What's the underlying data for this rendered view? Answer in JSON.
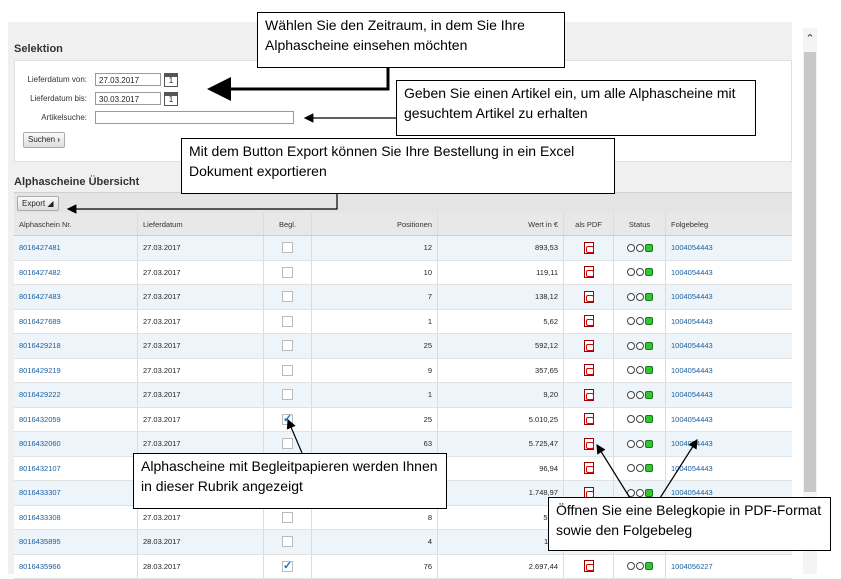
{
  "selektion": {
    "title": "Selektion",
    "lieferdatum_von_label": "Lieferdatum von:",
    "lieferdatum_von_value": "27.03.2017",
    "lieferdatum_bis_label": "Lieferdatum bis:",
    "lieferdatum_bis_value": "30.03.2017",
    "calendar_day": "1",
    "artikelsuche_label": "Artikelsuche:",
    "artikelsuche_value": "",
    "suchen_label": "Suchen",
    "suchen_chevron": "›"
  },
  "overview": {
    "title": "Alphascheine Übersicht",
    "export_label": "Export"
  },
  "table": {
    "headers": [
      "Alphaschein Nr.",
      "Lieferdatum",
      "Begl.",
      "Positionen",
      "Wert in €",
      "als PDF",
      "Status",
      "Folgebeleg"
    ],
    "rows": [
      {
        "nr": "8016427481",
        "datum": "27.03.2017",
        "begl": false,
        "pos": "12",
        "wert": "893,53",
        "folge": "1004054443"
      },
      {
        "nr": "8016427482",
        "datum": "27.03.2017",
        "begl": false,
        "pos": "10",
        "wert": "119,11",
        "folge": "1004054443"
      },
      {
        "nr": "8016427483",
        "datum": "27.03.2017",
        "begl": false,
        "pos": "7",
        "wert": "138,12",
        "folge": "1004054443"
      },
      {
        "nr": "8016427689",
        "datum": "27.03.2017",
        "begl": false,
        "pos": "1",
        "wert": "5,62",
        "folge": "1004054443"
      },
      {
        "nr": "8016429218",
        "datum": "27.03.2017",
        "begl": false,
        "pos": "25",
        "wert": "592,12",
        "folge": "1004054443"
      },
      {
        "nr": "8016429219",
        "datum": "27.03.2017",
        "begl": false,
        "pos": "9",
        "wert": "357,65",
        "folge": "1004054443"
      },
      {
        "nr": "8016429222",
        "datum": "27.03.2017",
        "begl": false,
        "pos": "1",
        "wert": "9,20",
        "folge": "1004054443"
      },
      {
        "nr": "8016432059",
        "datum": "27.03.2017",
        "begl": true,
        "pos": "25",
        "wert": "5.010,25",
        "folge": "1004054443"
      },
      {
        "nr": "8016432060",
        "datum": "27.03.2017",
        "begl": false,
        "pos": "63",
        "wert": "5.725,47",
        "folge": "1004054443"
      },
      {
        "nr": "8016432107",
        "datum": "",
        "begl": false,
        "pos": "",
        "wert": "96,94",
        "folge": "1004054443"
      },
      {
        "nr": "8016433307",
        "datum": "",
        "begl": false,
        "pos": "",
        "wert": "1.748,97",
        "folge": "1004054443"
      },
      {
        "nr": "8016433308",
        "datum": "27.03.2017",
        "begl": false,
        "pos": "8",
        "wert": "577.",
        "folge": ""
      },
      {
        "nr": "8016435895",
        "datum": "28.03.2017",
        "begl": false,
        "pos": "4",
        "wert": "110,",
        "folge": ""
      },
      {
        "nr": "8016435966",
        "datum": "28.03.2017",
        "begl": true,
        "pos": "76",
        "wert": "2.697,44",
        "folge": "1004056227"
      }
    ]
  },
  "icons": {
    "pdf": "pdf-icon",
    "status": "status-traffic-light-icon",
    "calendar": "calendar-icon",
    "scroll_up": "chevron-up-icon"
  },
  "callouts": {
    "zeitraum": "Wählen Sie den Zeitraum, in dem Sie Ihre Alphascheine einsehen möchten",
    "artikel": "Geben Sie einen Artikel ein, um alle Alphascheine mit gesuchtem Artikel zu erhalten",
    "export": "Mit dem Button Export können Sie Ihre Bestellung in ein Excel Dokument exportieren",
    "begleit": "Alphascheine mit Begleitpapieren werden Ihnen in dieser Rubrik angezeigt",
    "pdf": "Öffnen Sie eine Belegkopie in PDF-Format sowie den Folgebeleg"
  },
  "colors": {
    "link": "#1a5fa0",
    "status_green": "#33c533",
    "row_alt": "#eef5fa"
  }
}
